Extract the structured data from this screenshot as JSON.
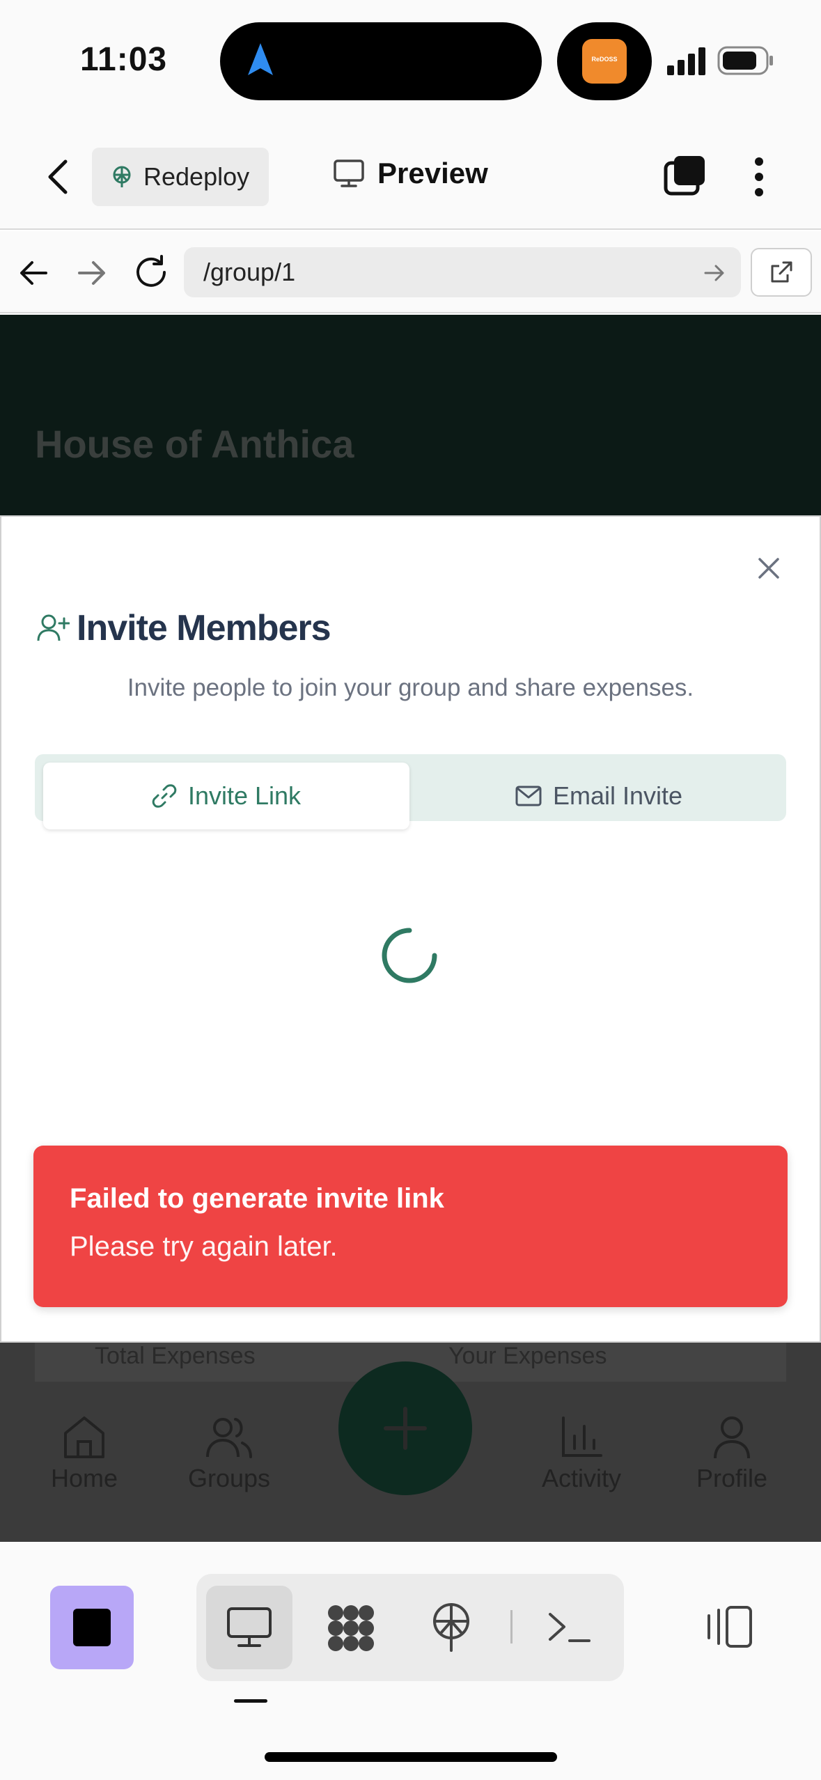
{
  "status_bar": {
    "time": "11:03",
    "app_badge_text": "ReDOSS"
  },
  "toolbar": {
    "redeploy_label": "Redeploy",
    "preview_label": "Preview"
  },
  "browser": {
    "url": "/group/1"
  },
  "page": {
    "group_title": "House of Anthica",
    "stats": {
      "total_label": "Total Expenses",
      "yours_label": "Your Expenses"
    },
    "nav": {
      "home": "Home",
      "groups": "Groups",
      "activity": "Activity",
      "profile": "Profile"
    }
  },
  "modal": {
    "title": "Invite Members",
    "description": "Invite people to join your group and share expenses.",
    "tabs": {
      "invite_link": "Invite Link",
      "email_invite": "Email Invite"
    },
    "active_tab": "invite_link"
  },
  "toast": {
    "title": "Failed to generate invite link",
    "message": "Please try again later."
  },
  "colors": {
    "accent": "#2f7a63",
    "toast_bg": "#ef4444",
    "stop_button": "#b8a7f7",
    "title": "#25344d"
  },
  "icons": [
    "back-icon",
    "redeploy-icon",
    "monitor-icon",
    "tabs-icon",
    "more-icon",
    "browser-back-icon",
    "browser-forward-icon",
    "reload-icon",
    "go-icon",
    "open-external-icon",
    "close-icon",
    "user-plus-icon",
    "link-icon",
    "mail-icon",
    "loading-spinner-icon",
    "home-icon",
    "groups-icon",
    "plus-icon",
    "activity-icon",
    "profile-icon",
    "stop-icon",
    "monitor-icon",
    "workflow-icon",
    "deploy-icon",
    "terminal-icon",
    "split-view-icon"
  ]
}
